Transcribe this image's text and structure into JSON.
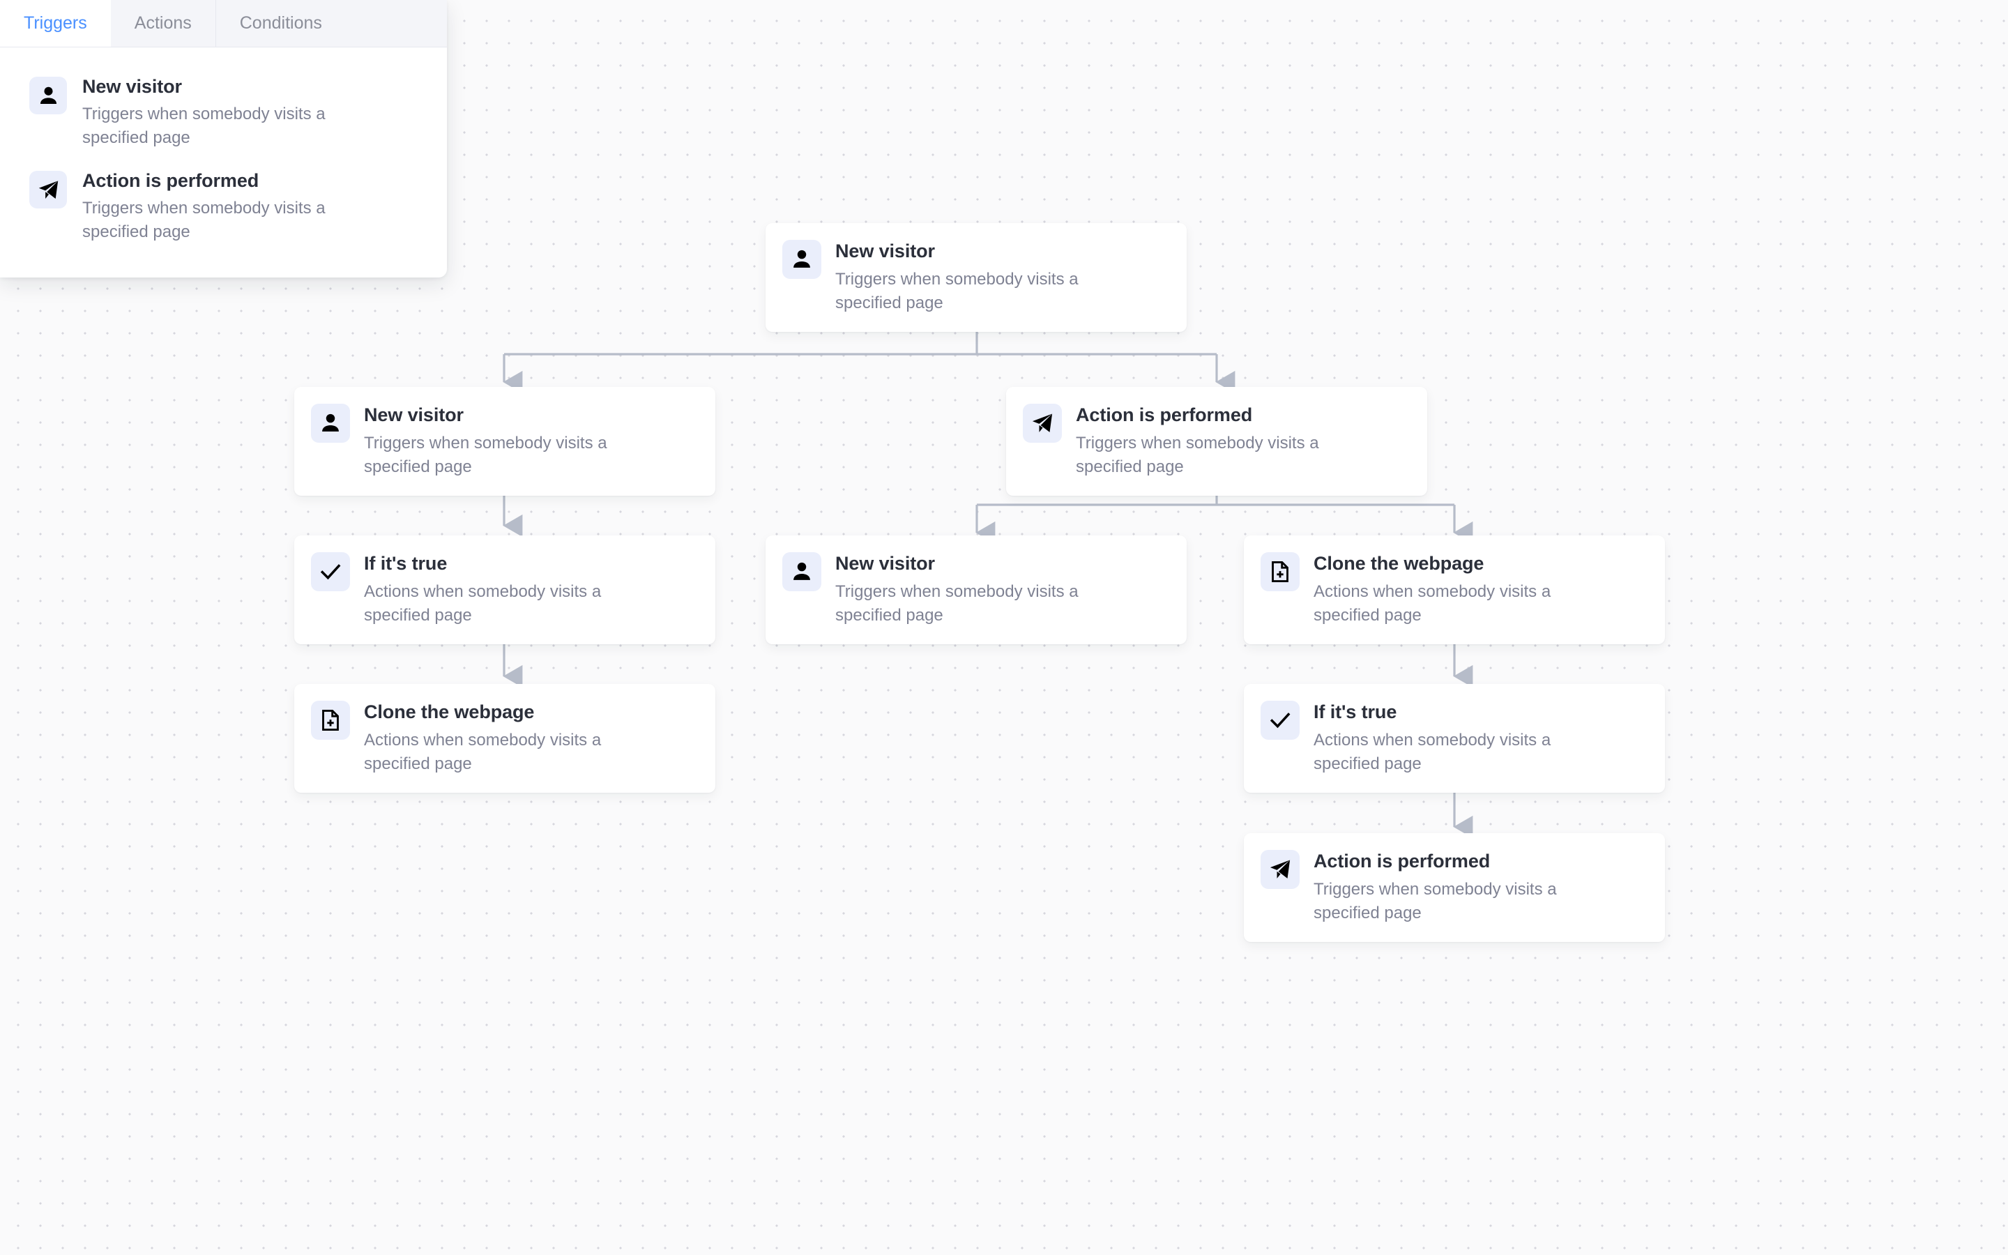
{
  "panel": {
    "tabs": [
      {
        "label": "Triggers",
        "active": true
      },
      {
        "label": "Actions",
        "active": false
      },
      {
        "label": "Conditions",
        "active": false
      }
    ],
    "items": [
      {
        "icon": "person-icon",
        "title": "New visitor",
        "description": "Triggers when somebody visits a specified page"
      },
      {
        "icon": "send-icon",
        "title": "Action is performed",
        "description": "Triggers when somebody visits a specified page"
      }
    ]
  },
  "canvas": {
    "nodes": [
      {
        "id": "n0",
        "icon": "person-icon",
        "title": "New visitor",
        "description": "Triggers when somebody visits a specified page"
      },
      {
        "id": "n1",
        "icon": "person-icon",
        "title": "New visitor",
        "description": "Triggers when somebody visits a specified page"
      },
      {
        "id": "n2",
        "icon": "send-icon",
        "title": "Action is performed",
        "description": "Triggers when somebody visits a specified page"
      },
      {
        "id": "n3",
        "icon": "check-icon",
        "title": "If it's true",
        "description": "Actions when somebody visits a specified page"
      },
      {
        "id": "n4",
        "icon": "person-icon",
        "title": "New visitor",
        "description": "Triggers when somebody visits a specified page"
      },
      {
        "id": "n5",
        "icon": "document-plus-icon",
        "title": "Clone the webpage",
        "description": "Actions when somebody visits a specified page"
      },
      {
        "id": "n6",
        "icon": "document-plus-icon",
        "title": "Clone the webpage",
        "description": "Actions when somebody visits a specified page"
      },
      {
        "id": "n7",
        "icon": "check-icon",
        "title": "If it's true",
        "description": "Actions when somebody visits a specified page"
      },
      {
        "id": "n8",
        "icon": "send-icon",
        "title": "Action is performed",
        "description": "Triggers when somebody visits a specified page"
      }
    ]
  },
  "colors": {
    "accent": "#4a90ff",
    "card_bg": "#ffffff",
    "icon_tile": "#eaeefb",
    "title": "#2b2f3a",
    "description": "#7f8293",
    "canvas_bg": "#fafafb",
    "grid_dot": "#d6d6dd",
    "connector": "#b6bcc9"
  }
}
